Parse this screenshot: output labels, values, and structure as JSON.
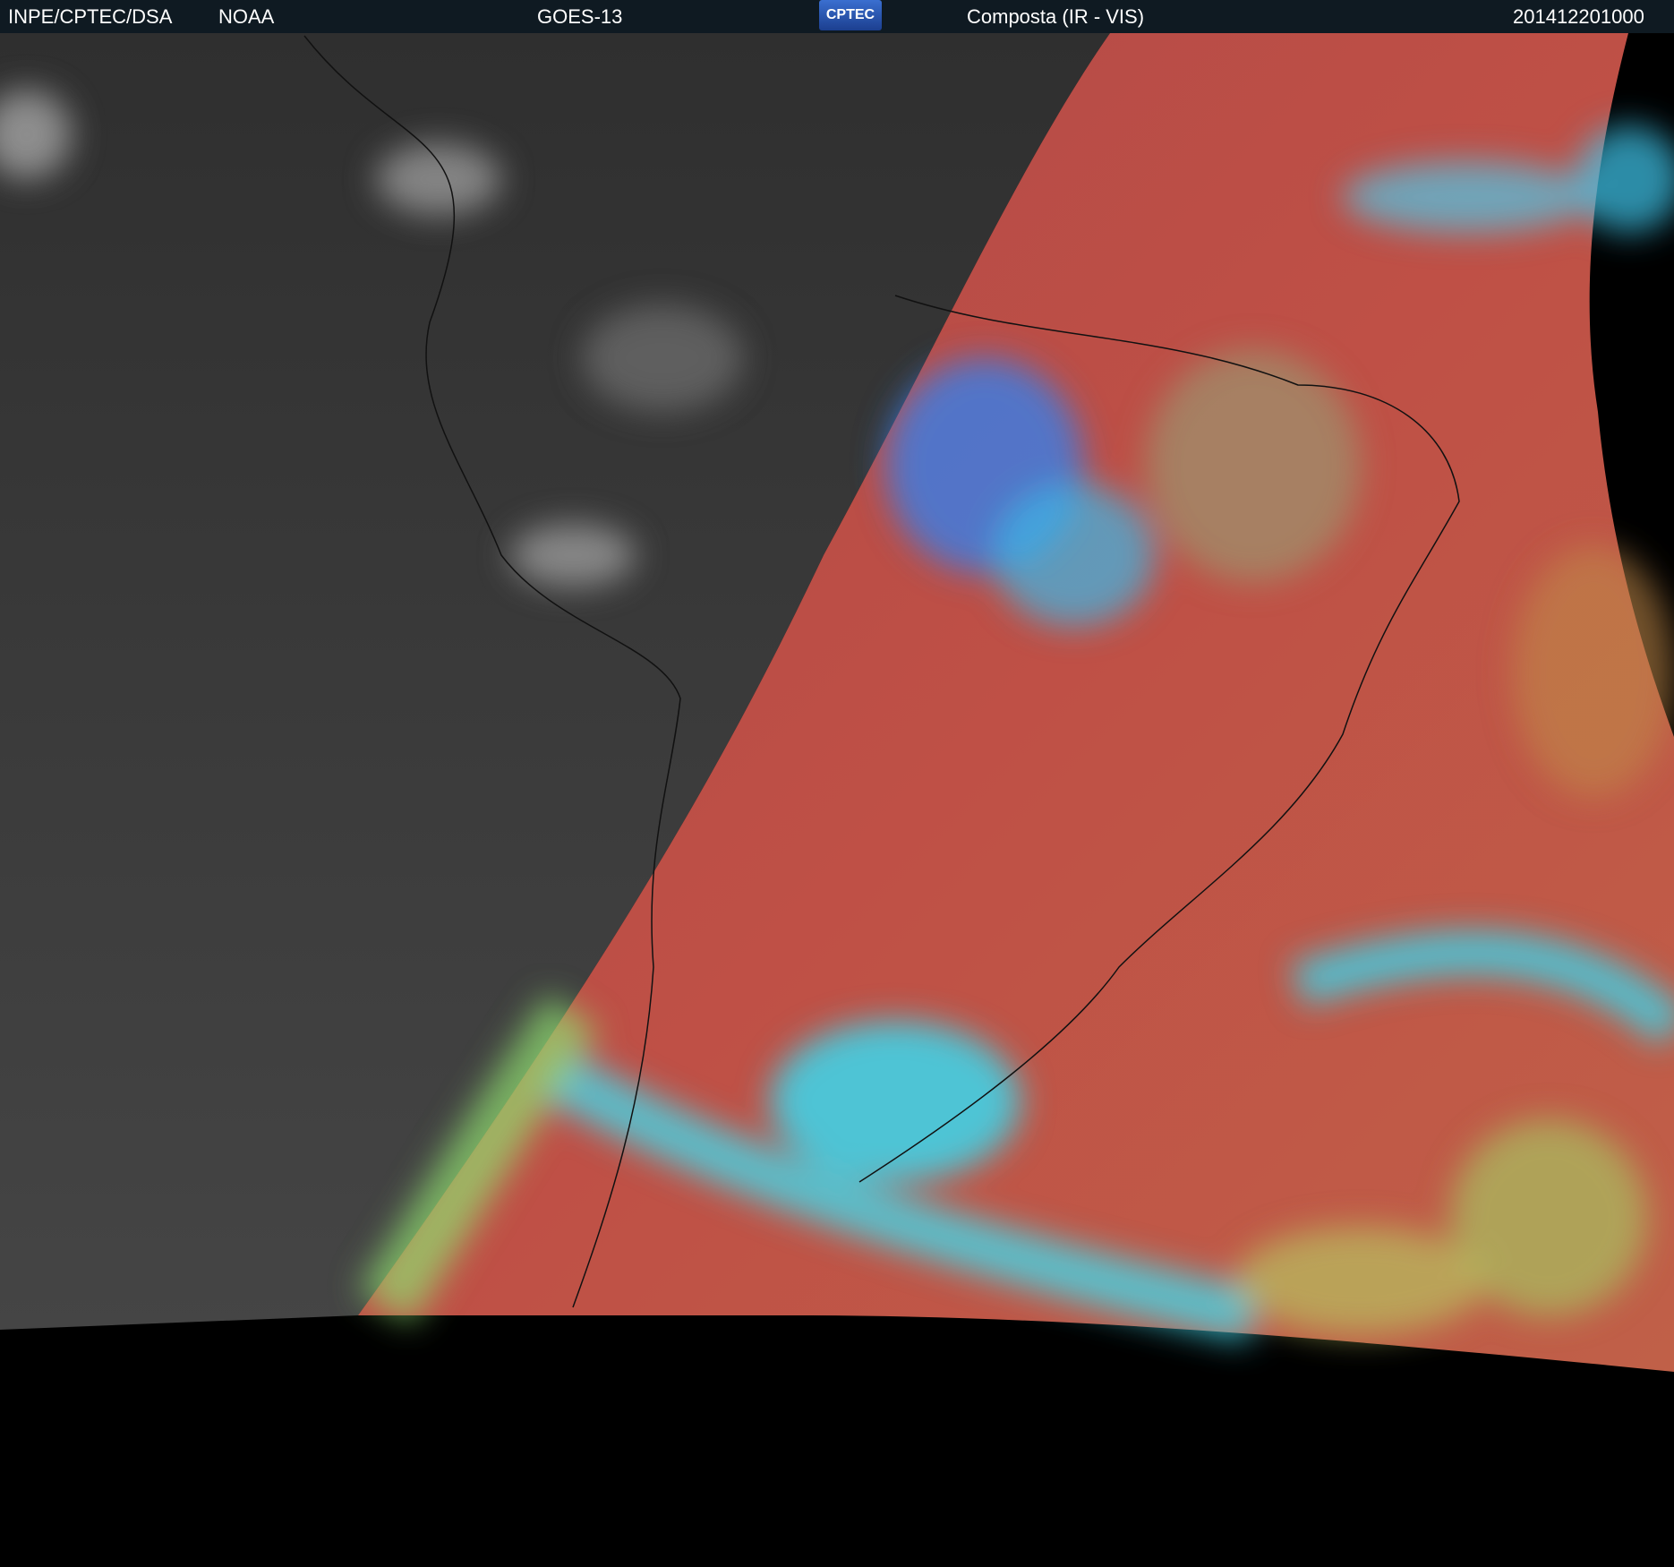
{
  "header": {
    "agency": "INPE/CPTEC/DSA",
    "partner": "NOAA",
    "satellite": "GOES-13",
    "logo_text": "CPTEC",
    "product": "Composta (IR - VIS)",
    "timestamp": "201412201000"
  },
  "colors": {
    "header_bg": "#0f1a22",
    "night_gray": "#3a3a3a",
    "composite_red": "#b84a4a",
    "cloud_cyan": "#3ad0e8"
  }
}
